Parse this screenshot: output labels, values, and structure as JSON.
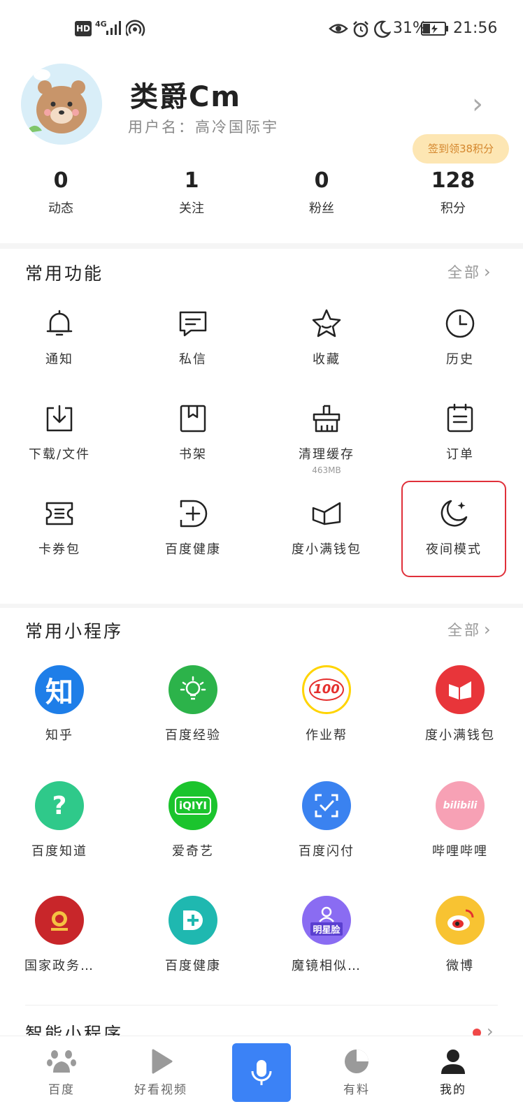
{
  "status_bar": {
    "left_badges": [
      "HD",
      "4G"
    ],
    "battery": "31%",
    "time": "21:56"
  },
  "profile": {
    "nickname": "类爵Cm",
    "username": "用户名：高冷国际宇",
    "signin_badge": "签到领38积分",
    "stats": [
      {
        "value": "0",
        "label": "动态"
      },
      {
        "value": "1",
        "label": "关注"
      },
      {
        "value": "0",
        "label": "粉丝"
      },
      {
        "value": "128",
        "label": "积分"
      }
    ]
  },
  "common_functions": {
    "title": "常用功能",
    "more": "全部",
    "items": [
      {
        "label": "通知",
        "icon": "bell-icon"
      },
      {
        "label": "私信",
        "icon": "message-icon"
      },
      {
        "label": "收藏",
        "icon": "star-icon"
      },
      {
        "label": "历史",
        "icon": "clock-icon"
      },
      {
        "label": "下载/文件",
        "icon": "download-icon"
      },
      {
        "label": "书架",
        "icon": "bookmark-icon"
      },
      {
        "label": "清理缓存",
        "icon": "broom-icon",
        "sub": "463MB"
      },
      {
        "label": "订单",
        "icon": "order-icon"
      },
      {
        "label": "卡券包",
        "icon": "coupon-icon"
      },
      {
        "label": "百度健康",
        "icon": "health-plus-icon"
      },
      {
        "label": "度小满钱包",
        "icon": "wallet-icon"
      },
      {
        "label": "夜间模式",
        "icon": "moon-icon"
      }
    ]
  },
  "mini_programs": {
    "title": "常用小程序",
    "more": "全部",
    "items": [
      {
        "label": "知乎",
        "glyph": "知",
        "color": "#1e7ee8"
      },
      {
        "label": "百度经验",
        "glyph": "",
        "color": "#2cb34a"
      },
      {
        "label": "作业帮",
        "glyph": "100",
        "color": "#ffffff"
      },
      {
        "label": "度小满钱包",
        "glyph": "",
        "color": "#e8353a"
      },
      {
        "label": "百度知道",
        "glyph": "?",
        "color": "#2fc98a"
      },
      {
        "label": "爱奇艺",
        "glyph": "iQIYI",
        "color": "#1bc42d"
      },
      {
        "label": "百度闪付",
        "glyph": "",
        "color": "#3a82f0"
      },
      {
        "label": "哔哩哔哩",
        "glyph": "bilibili",
        "color": "#f7a1b5"
      },
      {
        "label": "国家政务…",
        "glyph": "",
        "color": "#c8262a"
      },
      {
        "label": "百度健康",
        "glyph": "",
        "color": "#1fb8b0"
      },
      {
        "label": "魔镜相似…",
        "glyph": "明星脸",
        "color": "#8a6cf2"
      },
      {
        "label": "微博",
        "glyph": "",
        "color": "#f8c332"
      }
    ]
  },
  "smart_programs": {
    "title": "智能小程序"
  },
  "bottom_nav": {
    "tabs": [
      {
        "label": "百度",
        "icon": "baidu-paw-icon"
      },
      {
        "label": "好看视频",
        "icon": "play-icon"
      },
      {
        "label": "",
        "icon": "microphone-icon"
      },
      {
        "label": "有料",
        "icon": "feed-icon"
      },
      {
        "label": "我的",
        "icon": "profile-icon"
      }
    ]
  },
  "colors": {
    "accent_blue": "#3b82f6",
    "highlight_red": "#e0303a",
    "signin_bg": "#fde6b3"
  }
}
